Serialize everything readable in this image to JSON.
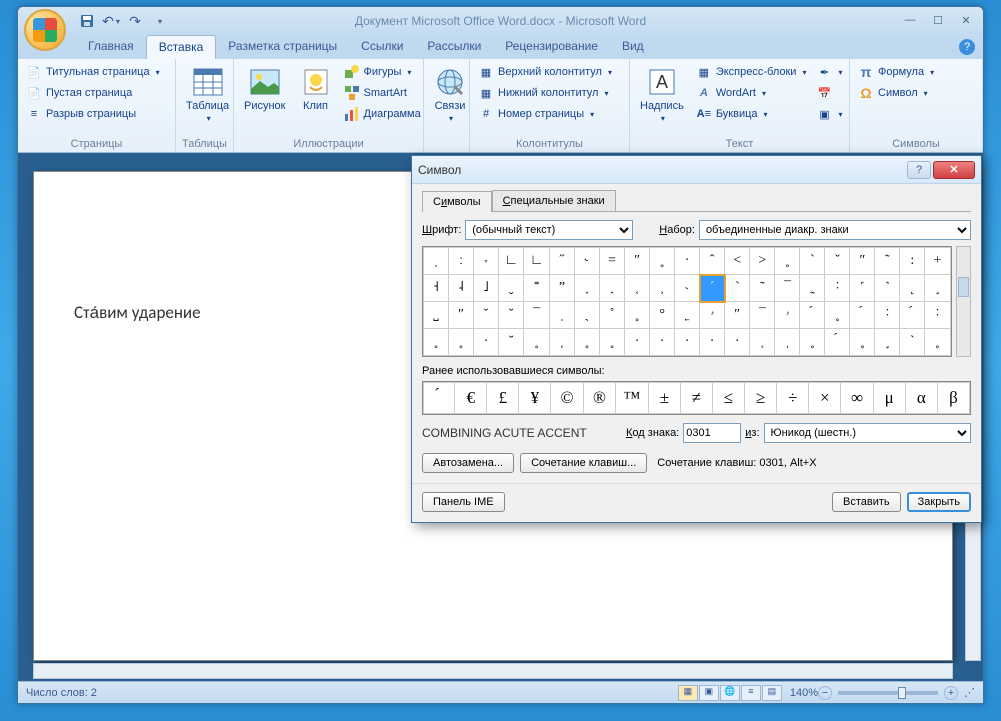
{
  "title": "Документ Microsoft Office Word.docx - Microsoft Word",
  "tabs": [
    "Главная",
    "Вставка",
    "Разметка страницы",
    "Ссылки",
    "Рассылки",
    "Рецензирование",
    "Вид"
  ],
  "active_tab": 1,
  "ribbon": {
    "pages": {
      "label": "Страницы",
      "title_page": "Титульная страница",
      "blank": "Пустая страница",
      "break": "Разрыв страницы"
    },
    "tables": {
      "label": "Таблицы",
      "table": "Таблица"
    },
    "illus": {
      "label": "Иллюстрации",
      "pic": "Рисунок",
      "clip": "Клип",
      "shapes": "Фигуры",
      "smartart": "SmartArt",
      "chart": "Диаграмма"
    },
    "links": {
      "label": "",
      "links": "Связи"
    },
    "headers": {
      "label": "Колонтитулы",
      "top": "Верхний колонтитул",
      "bottom": "Нижний колонтитул",
      "num": "Номер страницы"
    },
    "text": {
      "label": "Текст",
      "textbox": "Надпись",
      "quick": "Экспресс-блоки",
      "wordart": "WordArt",
      "dropcap": "Буквица"
    },
    "symbols": {
      "label": "Символы",
      "formula": "Формула",
      "symbol": "Символ"
    }
  },
  "document_text": "Ста́вим ударение",
  "statusbar": {
    "words": "Число слов: 2",
    "zoom": "140%"
  },
  "dialog": {
    "title": "Символ",
    "tab1": {
      "pre": "С",
      "ul": "и",
      "post": "мволы"
    },
    "tab2": {
      "pre": "",
      "ul": "С",
      "post": "пециальные знаки"
    },
    "font_label": {
      "ul": "Ш",
      "post": "рифт:"
    },
    "font_value": "(обычный текст)",
    "set_label": {
      "ul": "Н",
      "post": "абор:"
    },
    "set_value": "объединенные диакр. знаки",
    "grid": [
      [
        "ˌ",
        "ː",
        "˕",
        "∟",
        "∟",
        "˝",
        "˞",
        "=",
        "″",
        "˳",
        "·",
        "ˆ",
        "<",
        ">",
        "˳",
        "`",
        "ˇ",
        "″",
        "˜",
        ":",
        "+"
      ],
      [
        "˧",
        "˨",
        "˩",
        "ˬ",
        "˭",
        "ˮ",
        "˯",
        "˰",
        "˱",
        "˲",
        "˴",
        "ˊ",
        "ˋ",
        "˜",
        "¯",
        "˷",
        "˸",
        "˹",
        "˺",
        "˻",
        "˼"
      ],
      [
        "˽",
        "″",
        "ˇ",
        "˘",
        "¯",
        "ˌ",
        "ˎ",
        "˚",
        "˳",
        "°",
        "˿",
        "ۥ",
        "″",
        "¯",
        "ۥ",
        "́",
        "˳",
        "́",
        "˸",
        "́",
        "˸"
      ],
      [
        "˳",
        "˳",
        "·",
        "˘",
        "˳",
        "˱",
        "˳",
        "˳",
        "·",
        "·",
        "·",
        "·",
        "·",
        "˱",
        "ˌ",
        "˳",
        "́",
        "˳",
        "˼",
        "ˋ",
        "˳"
      ]
    ],
    "sel_row": 1,
    "sel_col": 11,
    "recent_label": "Ранее использовавшиеся символы:",
    "recent": [
      "́",
      "€",
      "£",
      "¥",
      "©",
      "®",
      "™",
      "±",
      "≠",
      "≤",
      "≥",
      "÷",
      "×",
      "∞",
      "μ",
      "α",
      "β"
    ],
    "char_name": "COMBINING ACUTE ACCENT",
    "code_label": {
      "ul": "К",
      "post": "од знака:"
    },
    "code_value": "0301",
    "from_label": {
      "ul": "и",
      "post": "з:"
    },
    "from_value": "Юникод (шестн.)",
    "autocorr": "Автозамена...",
    "shortcut_btn": "Сочетание клавиш...",
    "shortcut_text": "Сочетание клавиш: 0301, Alt+X",
    "ime": "Панель IME",
    "insert": "Вставить",
    "close": "Закрыть"
  }
}
